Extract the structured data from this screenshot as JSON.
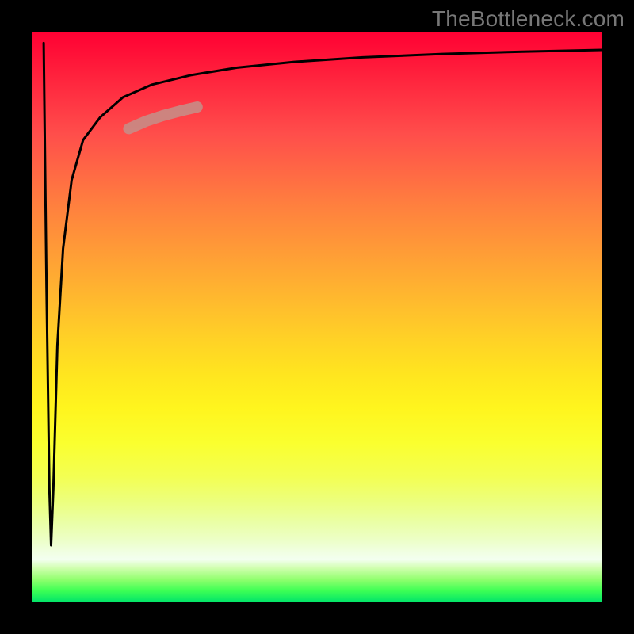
{
  "watermark": {
    "text": "TheBottleneck.com"
  },
  "chart_data": {
    "type": "line",
    "title": "",
    "xlabel": "",
    "ylabel": "",
    "xlim": [
      0,
      100
    ],
    "ylim": [
      0,
      100
    ],
    "grid": false,
    "legend": false,
    "series": [
      {
        "name": "main-curve",
        "color": "#000000",
        "x": [
          2.1,
          2.6,
          3.1,
          3.4,
          3.8,
          4.5,
          5.5,
          7,
          9,
          12,
          16,
          21,
          28,
          36,
          46,
          58,
          72,
          86,
          100
        ],
        "y": [
          98,
          55,
          20,
          10,
          20,
          45,
          62,
          74,
          81,
          85,
          88.5,
          90.7,
          92.4,
          93.7,
          94.7,
          95.5,
          96.1,
          96.5,
          96.8
        ]
      },
      {
        "name": "highlight-segment",
        "color": "#c98a84",
        "thickness": 10,
        "x": [
          17,
          20,
          23,
          26,
          29
        ],
        "y": [
          83,
          84.3,
          85.3,
          86.1,
          86.8
        ]
      }
    ],
    "background_gradient": {
      "top": "#ff0033",
      "mid": "#ffe51f",
      "bottom": "#00e36a"
    }
  }
}
